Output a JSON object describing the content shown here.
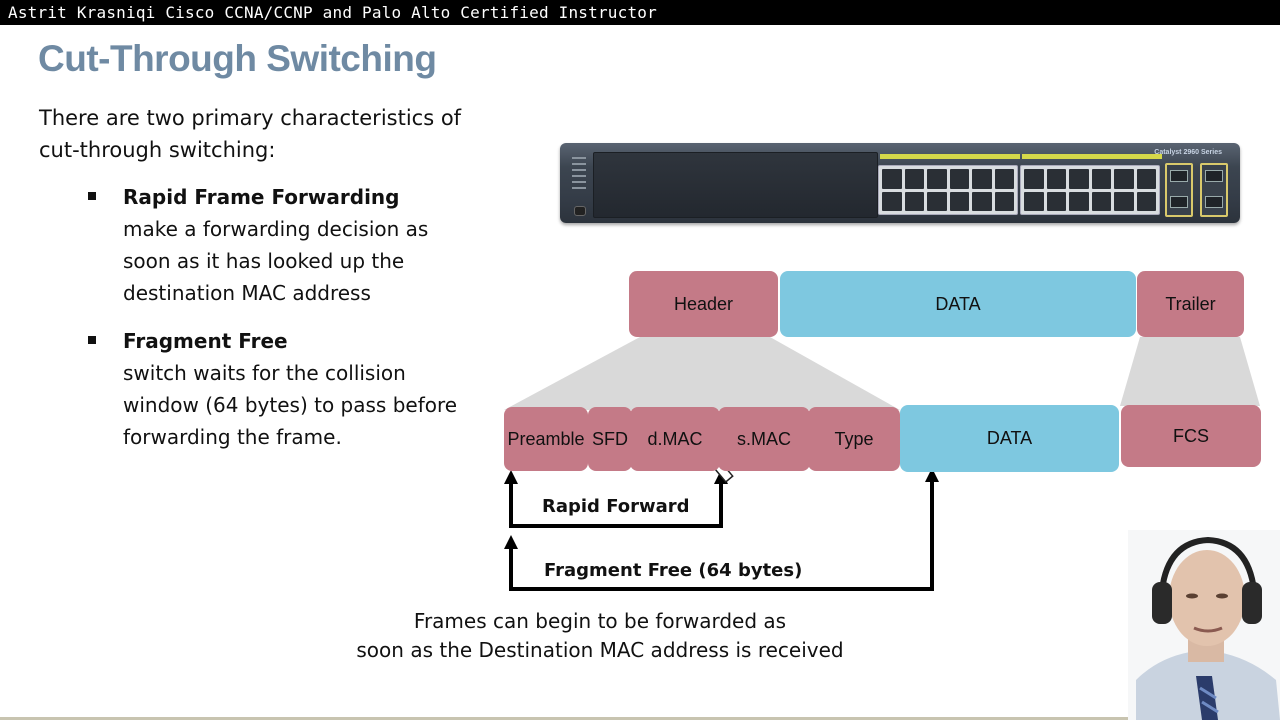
{
  "overlay": {
    "instructor_banner": "Astrit Krasniqi Cisco CCNA/CCNP and Palo Alto Certified Instructor"
  },
  "slide": {
    "title": "Cut-Through Switching",
    "intro": "There are two primary characteristics of cut-through switching:",
    "bullets": [
      {
        "title": "Rapid Frame Forwarding",
        "text": "make a forwarding decision as soon as it has looked up the destination MAC address"
      },
      {
        "title": "Fragment Free",
        "text": "switch waits for the collision window (64 bytes) to pass before forwarding the frame."
      }
    ],
    "switch_image": {
      "icon": "network-switch-image",
      "brand_label": "Catalyst 2960 Series"
    },
    "frame_diagram": {
      "top_row": [
        {
          "label": "Header",
          "color": "#c47a87"
        },
        {
          "label": "DATA",
          "color": "#7ec8e0"
        },
        {
          "label": "Trailer",
          "color": "#c47a87"
        }
      ],
      "bottom_row": [
        {
          "label": "Preamble",
          "color": "#c47a87"
        },
        {
          "label": "SFD",
          "color": "#c47a87"
        },
        {
          "label": "d.MAC",
          "color": "#c47a87",
          "underlined": true,
          "underline_color": "#d42020"
        },
        {
          "label": "s.MAC",
          "color": "#c47a87"
        },
        {
          "label": "Type",
          "color": "#c47a87"
        },
        {
          "label": "DATA",
          "color": "#7ec8e0"
        },
        {
          "label": "FCS",
          "color": "#c47a87"
        }
      ],
      "arrows": [
        {
          "label": "Rapid Forward"
        },
        {
          "label": "Fragment Free (64 bytes)"
        }
      ]
    },
    "caption": {
      "line1": "Frames can begin to be forwarded as",
      "line2": "soon as the Destination MAC address is received"
    }
  },
  "webcam": {
    "icon": "presenter-webcam"
  }
}
